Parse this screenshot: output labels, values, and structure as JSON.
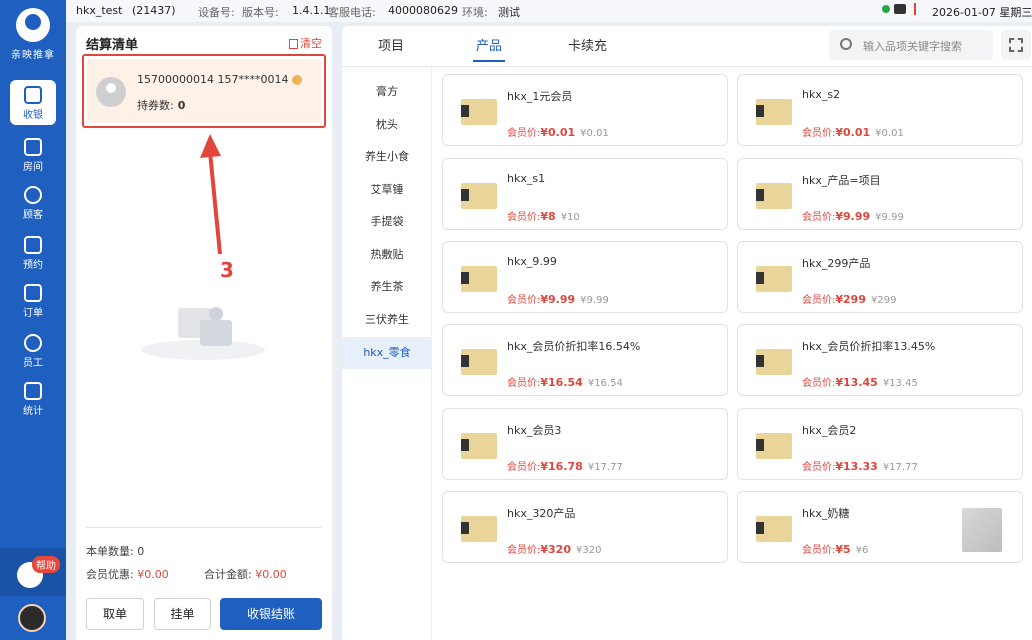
{
  "topbar": {
    "store": "hkx_test",
    "store_id": "(21437)",
    "device_label": "设备号:",
    "version_label": "版本号:",
    "version": "1.4.1.1",
    "service_label": "客服电话:",
    "service_phone": "4000080629",
    "env_label": "环境:",
    "env": "测试",
    "datetime": "2026-01-07 星期三"
  },
  "sidebar": {
    "logo_text": "亲映推拿",
    "items": [
      {
        "label": "收银",
        "icon": "monitor-icon"
      },
      {
        "label": "房间",
        "icon": "home-icon"
      },
      {
        "label": "顾客",
        "icon": "user-icon"
      },
      {
        "label": "预约",
        "icon": "calendar-clock-icon"
      },
      {
        "label": "订单",
        "icon": "clipboard-icon"
      },
      {
        "label": "员工",
        "icon": "staff-icon"
      },
      {
        "label": "统计",
        "icon": "chart-icon"
      }
    ],
    "help_badge": "帮助"
  },
  "checkout": {
    "title": "结算清单",
    "clear": "清空",
    "member": {
      "phone": "15700000014 157****0014",
      "coupon_label": "持券数:",
      "coupon_count": "0"
    },
    "annotation_number": "3",
    "count_label": "本单数量:",
    "count": "0",
    "discount_label": "会员优惠:",
    "discount": "¥0.00",
    "total_label": "合计金额:",
    "total": "¥0.00",
    "buttons": {
      "cancel": "取单",
      "hold": "挂单",
      "pay": "收银结账"
    }
  },
  "main": {
    "tabs": [
      "项目",
      "产品",
      "卡续充"
    ],
    "search_placeholder": "输入品项关键字搜索",
    "categories": [
      "膏方",
      "枕头",
      "养生小食",
      "艾草锤",
      "手提袋",
      "热敷贴",
      "养生茶",
      "三伏养生",
      "hkx_零食"
    ],
    "member_price_label": "会员价:",
    "products": [
      {
        "name": "hkx_1元会员",
        "member_price": "¥0.01",
        "price": "¥0.01"
      },
      {
        "name": "hkx_s2",
        "member_price": "¥0.01",
        "price": "¥0.01"
      },
      {
        "name": "hkx_s1",
        "member_price": "¥8",
        "price": "¥10"
      },
      {
        "name": "hkx_产品=项目",
        "member_price": "¥9.99",
        "price": "¥9.99"
      },
      {
        "name": "hkx_9.99",
        "member_price": "¥9.99",
        "price": "¥9.99"
      },
      {
        "name": "hkx_299产品",
        "member_price": "¥299",
        "price": "¥299"
      },
      {
        "name": "hkx_会员价折扣率16.54%",
        "member_price": "¥16.54",
        "price": "¥16.54"
      },
      {
        "name": "hkx_会员价折扣率13.45%",
        "member_price": "¥13.45",
        "price": "¥13.45"
      },
      {
        "name": "hkx_会员3",
        "member_price": "¥16.78",
        "price": "¥17.77"
      },
      {
        "name": "hkx_会员2",
        "member_price": "¥13.33",
        "price": "¥17.77"
      },
      {
        "name": "hkx_320产品",
        "member_price": "¥320",
        "price": "¥320"
      },
      {
        "name": "hkx_奶糖",
        "member_price": "¥5",
        "price": "¥6"
      }
    ]
  }
}
